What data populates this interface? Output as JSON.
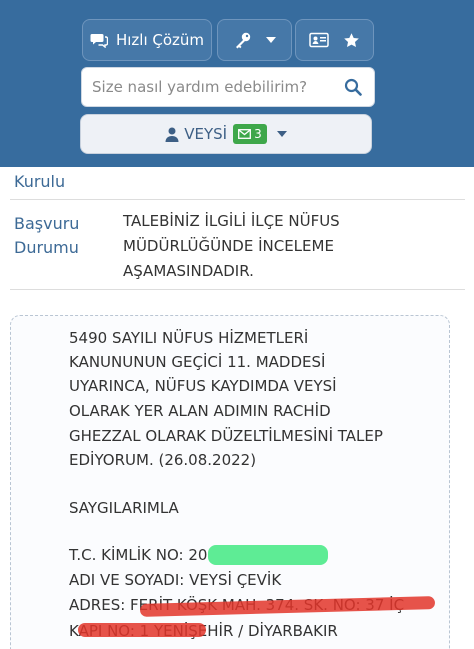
{
  "header": {
    "help_button": {
      "label": "Hızlı Çözüm",
      "icon": "chat-icon"
    },
    "key_button": {
      "icon": "key-icon"
    },
    "card_button": {
      "icon": "id-card-icon",
      "star_icon": "star-icon"
    },
    "search": {
      "placeholder": "Size nasıl yardım edebilirim?",
      "icon": "search-icon"
    },
    "user": {
      "name": "VEYSİ",
      "mail_count": "3",
      "icons": [
        "user-icon",
        "mail-icon",
        "caret-down-icon"
      ]
    }
  },
  "info": {
    "kurulu_label": "Kurulu",
    "status_label_line1": "Başvuru",
    "status_label_line2": "Durumu",
    "status_line1": "TALEBİNİZ İLGİLİ İLÇE NÜFUS",
    "status_line2": "MÜDÜRLÜĞÜNDE İNCELEME",
    "status_line3": "AŞAMASINDADIR."
  },
  "letter": {
    "lines": [
      "5490 SAYILI NÜFUS HİZMETLERİ",
      "KANUNUNUN GEÇİCİ 11. MADDESİ",
      "UYARINCA, NÜFUS KAYDIMDA VEYSİ",
      "OLARAK YER ALAN ADIMIN RACHİD",
      "GHEZZAL OLARAK DÜZELTİLMESİNİ TALEP",
      "EDİYORUM. (26.08.2022)"
    ],
    "closing": "SAYGILARIMLA",
    "tc_label": "T.C. KİMLİK NO: 20",
    "name_line": "ADI VE SOYADI: VEYSİ ÇEVİK",
    "address_line1": "ADRES: FERİT KÖŞK MAH. 374. SK. NO: 37 İÇ",
    "address_line2": "KAPI NO: 1 YENİŞEHİR / DİYARBAKIR"
  },
  "colors": {
    "header_bg": "#376c9e",
    "label_blue": "#3d6a96",
    "badge_green": "#3ea74a",
    "redact_green": "#4dea8a",
    "redact_red": "#e2352a"
  }
}
